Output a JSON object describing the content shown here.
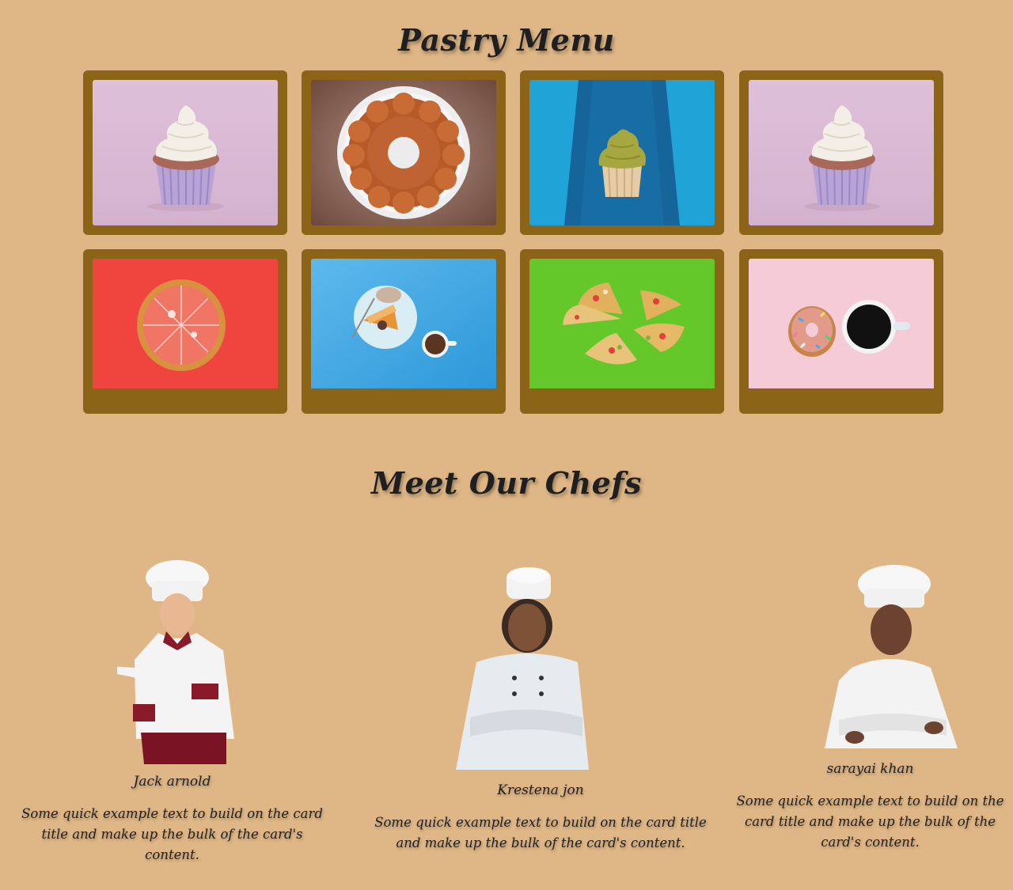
{
  "menu": {
    "title": "Pastry Menu",
    "items": [
      {
        "icon": "cupcake-pink-photo",
        "bg": "#dcbcd6"
      },
      {
        "icon": "bundt-cake-photo",
        "bg": "#7a5548"
      },
      {
        "icon": "green-cupcake-photo",
        "bg": "#1b98cf"
      },
      {
        "icon": "cupcake-pink-photo",
        "bg": "#dcbcd6"
      },
      {
        "icon": "pizza-red-photo",
        "bg": "#f0443f"
      },
      {
        "icon": "cake-coffee-photo",
        "bg": "#3aa6e2"
      },
      {
        "icon": "pizza-slices-photo",
        "bg": "#69c92a"
      },
      {
        "icon": "donut-coffee-photo",
        "bg": "#f6cdda"
      }
    ]
  },
  "chefs": {
    "title": "Meet Our Chefs",
    "items": [
      {
        "name": "Jack arnold",
        "text": "Some quick example text to build on the card title and make up the bulk of the card's content.",
        "icon": "chef-male-photo"
      },
      {
        "name": "Krestena jon",
        "text": "Some quick example text to build on the card title and make up the bulk of the card's content.",
        "icon": "chef-female-photo"
      },
      {
        "name": "sarayai khan",
        "text": "Some quick example text to build on the card title and make up the bulk of the card's content.",
        "icon": "chef-female-photo"
      }
    ]
  },
  "colors": {
    "background": "#dfb786",
    "frame": "#8b6418"
  }
}
